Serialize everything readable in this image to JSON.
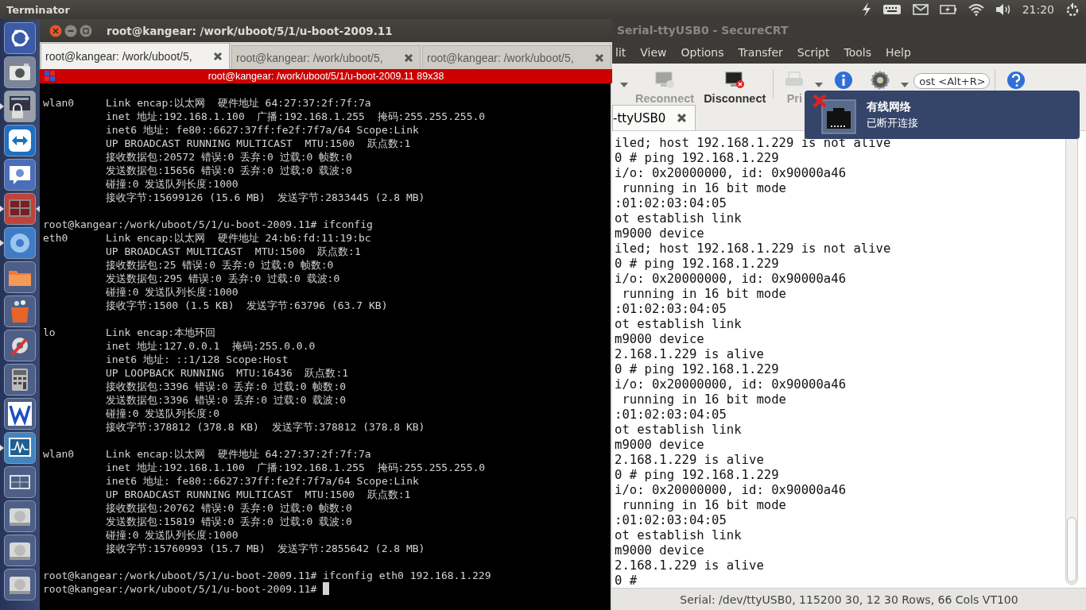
{
  "top_panel": {
    "app_title": "Terminator",
    "clock": "21:20"
  },
  "launcher": [
    {
      "kind": "ubuntu",
      "running": false,
      "focused": false
    },
    {
      "kind": "camera",
      "running": false,
      "focused": false
    },
    {
      "kind": "lock",
      "running": true,
      "focused": false
    },
    {
      "kind": "arrows",
      "running": false,
      "focused": false
    },
    {
      "kind": "chat",
      "running": false,
      "focused": false
    },
    {
      "kind": "terminal",
      "running": true,
      "focused": true
    },
    {
      "kind": "browser",
      "running": true,
      "focused": false
    },
    {
      "kind": "folder",
      "running": false,
      "focused": false
    },
    {
      "kind": "bag",
      "running": false,
      "focused": false
    },
    {
      "kind": "settings",
      "running": false,
      "focused": false
    },
    {
      "kind": "calculator",
      "running": false,
      "focused": false
    },
    {
      "kind": "writer",
      "running": false,
      "focused": false
    },
    {
      "kind": "monitor",
      "running": true,
      "focused": false
    },
    {
      "kind": "workspace",
      "running": false,
      "focused": false
    },
    {
      "kind": "disk",
      "running": false,
      "focused": false
    },
    {
      "kind": "disk",
      "running": false,
      "focused": false
    },
    {
      "kind": "disk",
      "running": false,
      "focused": false
    }
  ],
  "terminator": {
    "title": "root@kangear: /work/uboot/5/1/u-boot-2009.11",
    "tabs": [
      {
        "label": "root@kangear: /work/uboot/5,",
        "selected": true
      },
      {
        "label": "root@kangear: /work/uboot/5,",
        "selected": false
      },
      {
        "label": "root@kangear: /work/uboot/5,",
        "selected": false
      }
    ],
    "header": "root@kangear: /work/uboot/5/1/u-boot-2009.11 89x38",
    "blocks": [
      {
        "lines": [
          {
            "kind": "iface",
            "name": "wlan0",
            "text": "Link encap:以太网  硬件地址 64:27:37:2f:7f:7a"
          },
          {
            "kind": "detail",
            "text": "inet 地址:192.168.1.100  广播:192.168.1.255  掩码:255.255.255.0"
          },
          {
            "kind": "detail",
            "text": "inet6 地址: fe80::6627:37ff:fe2f:7f7a/64 Scope:Link"
          },
          {
            "kind": "detail",
            "text": "UP BROADCAST RUNNING MULTICAST  MTU:1500  跃点数:1"
          },
          {
            "kind": "detail",
            "text": "接收数据包:20572 错误:0 丢弃:0 过载:0 帧数:0"
          },
          {
            "kind": "detail",
            "text": "发送数据包:15656 错误:0 丢弃:0 过载:0 载波:0"
          },
          {
            "kind": "detail",
            "text": "碰撞:0 发送队列长度:1000"
          },
          {
            "kind": "detail",
            "text": "接收字节:15699126 (15.6 MB)  发送字节:2833445 (2.8 MB)"
          }
        ]
      },
      {
        "lines": [
          {
            "kind": "prompt",
            "text": "root@kangear:/work/uboot/5/1/u-boot-2009.11# ifconfig",
            "cursor": false
          },
          {
            "kind": "iface",
            "name": "eth0",
            "text": "Link encap:以太网  硬件地址 24:b6:fd:11:19:bc"
          },
          {
            "kind": "detail",
            "text": "UP BROADCAST MULTICAST  MTU:1500  跃点数:1"
          },
          {
            "kind": "detail",
            "text": "接收数据包:25 错误:0 丢弃:0 过载:0 帧数:0"
          },
          {
            "kind": "detail",
            "text": "发送数据包:295 错误:0 丢弃:0 过载:0 载波:0"
          },
          {
            "kind": "detail",
            "text": "碰撞:0 发送队列长度:1000"
          },
          {
            "kind": "detail",
            "text": "接收字节:1500 (1.5 KB)  发送字节:63796 (63.7 KB)"
          }
        ]
      },
      {
        "lines": [
          {
            "kind": "iface",
            "name": "lo",
            "text": "Link encap:本地环回"
          },
          {
            "kind": "detail",
            "text": "inet 地址:127.0.0.1  掩码:255.0.0.0"
          },
          {
            "kind": "detail",
            "text": "inet6 地址: ::1/128 Scope:Host"
          },
          {
            "kind": "detail",
            "text": "UP LOOPBACK RUNNING  MTU:16436  跃点数:1"
          },
          {
            "kind": "detail",
            "text": "接收数据包:3396 错误:0 丢弃:0 过载:0 帧数:0"
          },
          {
            "kind": "detail",
            "text": "发送数据包:3396 错误:0 丢弃:0 过载:0 载波:0"
          },
          {
            "kind": "detail",
            "text": "碰撞:0 发送队列长度:0"
          },
          {
            "kind": "detail",
            "text": "接收字节:378812 (378.8 KB)  发送字节:378812 (378.8 KB)"
          }
        ]
      },
      {
        "lines": [
          {
            "kind": "iface",
            "name": "wlan0",
            "text": "Link encap:以太网  硬件地址 64:27:37:2f:7f:7a"
          },
          {
            "kind": "detail",
            "text": "inet 地址:192.168.1.100  广播:192.168.1.255  掩码:255.255.255.0"
          },
          {
            "kind": "detail",
            "text": "inet6 地址: fe80::6627:37ff:fe2f:7f7a/64 Scope:Link"
          },
          {
            "kind": "detail",
            "text": "UP BROADCAST RUNNING MULTICAST  MTU:1500  跃点数:1"
          },
          {
            "kind": "detail",
            "text": "接收数据包:20762 错误:0 丢弃:0 过载:0 帧数:0"
          },
          {
            "kind": "detail",
            "text": "发送数据包:15819 错误:0 丢弃:0 过载:0 载波:0"
          },
          {
            "kind": "detail",
            "text": "碰撞:0 发送队列长度:1000"
          },
          {
            "kind": "detail",
            "text": "接收字节:15760993 (15.7 MB)  发送字节:2855642 (2.8 MB)"
          }
        ]
      },
      {
        "lines": [
          {
            "kind": "prompt",
            "text": "root@kangear:/work/uboot/5/1/u-boot-2009.11# ifconfig eth0 192.168.1.229",
            "cursor": false
          },
          {
            "kind": "prompt",
            "text": "root@kangear:/work/uboot/5/1/u-boot-2009.11#",
            "cursor": true
          }
        ]
      }
    ]
  },
  "securecrt": {
    "title": "Serial-ttyUSB0 - SecureCRT",
    "menu": [
      "lit",
      "View",
      "Options",
      "Transfer",
      "Script",
      "Tools",
      "Help"
    ],
    "toolbar": [
      {
        "kind": "dropdown"
      },
      {
        "kind": "reconnect",
        "label": "Reconnect",
        "disabled": true
      },
      {
        "kind": "disconnect",
        "label": "Disconnect",
        "disabled": false
      },
      {
        "kind": "separator"
      },
      {
        "kind": "print",
        "label": "Pri",
        "disabled": true
      },
      {
        "kind": "dropdown"
      },
      {
        "kind": "info"
      },
      {
        "kind": "gear"
      },
      {
        "kind": "dropdown"
      },
      {
        "kind": "field",
        "value": "ost <Alt+R>"
      },
      {
        "kind": "separator"
      },
      {
        "kind": "help"
      }
    ],
    "tab": {
      "label": "-ttyUSB0",
      "selected": true
    },
    "lines": [
      "iled; host 192.168.1.229 is not alive",
      "0 # ping 192.168.1.229",
      "i/o: 0x20000000, id: 0x90000a46",
      " running in 16 bit mode",
      ":01:02:03:04:05",
      "ot establish link",
      "m9000 device",
      "iled; host 192.168.1.229 is not alive",
      "0 # ping 192.168.1.229",
      "i/o: 0x20000000, id: 0x90000a46",
      " running in 16 bit mode",
      ":01:02:03:04:05",
      "ot establish link",
      "m9000 device",
      "2.168.1.229 is alive",
      "0 # ping 192.168.1.229",
      "i/o: 0x20000000, id: 0x90000a46",
      " running in 16 bit mode",
      ":01:02:03:04:05",
      "ot establish link",
      "m9000 device",
      "2.168.1.229 is alive",
      "0 # ping 192.168.1.229",
      "i/o: 0x20000000, id: 0x90000a46",
      " running in 16 bit mode",
      ":01:02:03:04:05",
      "ot establish link",
      "m9000 device",
      "2.168.1.229 is alive",
      "0 #"
    ],
    "status": "Serial: /dev/ttyUSB0, 115200  30, 12  30 Rows, 66 Cols  VT100"
  },
  "notification": {
    "title": "有线网络",
    "body": "已断开连接"
  }
}
